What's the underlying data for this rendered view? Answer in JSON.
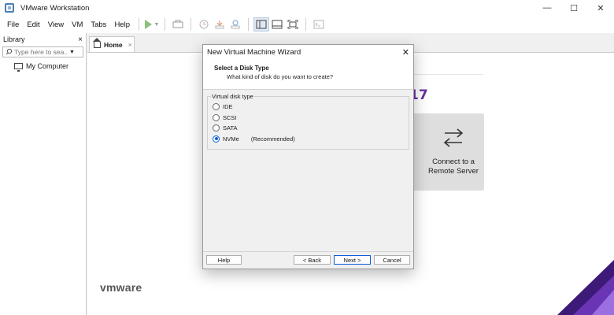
{
  "app": {
    "title": "VMware Workstation",
    "window_controls": {
      "minimize": "—",
      "maximize": "☐",
      "close": "✕"
    }
  },
  "menubar": {
    "items": [
      "File",
      "Edit",
      "View",
      "VM",
      "Tabs",
      "Help"
    ]
  },
  "library": {
    "title": "Library",
    "close": "×",
    "search": {
      "placeholder": "Type here to sea..."
    },
    "tree": [
      {
        "label": "My Computer",
        "icon": "monitor-icon"
      }
    ]
  },
  "tabs": [
    {
      "label": "Home",
      "close": "×",
      "icon": "home-icon"
    }
  ],
  "home": {
    "version_number": "17",
    "connect_card": {
      "label_line1": "Connect to a",
      "label_line2": "Remote Server",
      "icon": "swap-arrows-icon"
    },
    "brand": "vmware"
  },
  "dialog": {
    "title": "New Virtual Machine Wizard",
    "close": "✕",
    "step_title": "Select a Disk Type",
    "step_subtitle": "What kind of disk do you want to create?",
    "group_label": "Virtual disk type",
    "options": [
      {
        "label": "IDE",
        "checked": false
      },
      {
        "label": "SCSI",
        "checked": false
      },
      {
        "label": "SATA",
        "checked": false
      },
      {
        "label": "NVMe",
        "checked": true,
        "note": "(Recommended)"
      }
    ],
    "buttons": {
      "help": "Help",
      "back": "< Back",
      "next": "Next >",
      "cancel": "Cancel"
    }
  },
  "colors": {
    "accent": "#0c5fd6",
    "version": "#6a2fa0",
    "play": "#8ec07c"
  }
}
